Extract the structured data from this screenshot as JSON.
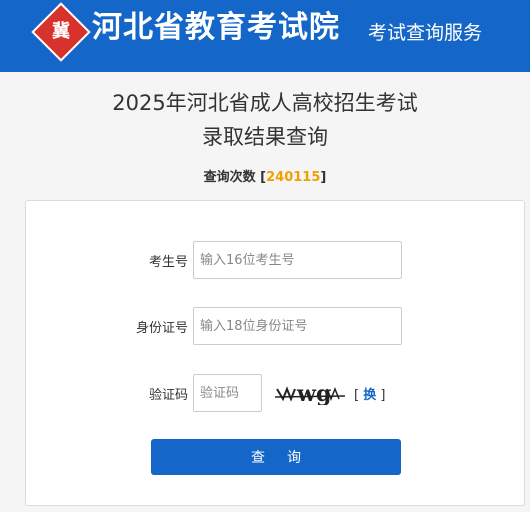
{
  "header": {
    "logo_text": "冀",
    "org_name": "河北省教育考试院",
    "service": "考试查询服务",
    "bg_color": "#1467c9"
  },
  "title_line1": "2025年河北省成人高校招生考试",
  "title_line2": "录取结果查询",
  "query_count": {
    "label": "查询次数",
    "open": "[",
    "value": "240115",
    "close": "]"
  },
  "form": {
    "exam_no": {
      "label": "考生号",
      "placeholder": "输入16位考生号"
    },
    "id_no": {
      "label": "身份证号",
      "placeholder": "输入18位身份证号"
    },
    "captcha": {
      "label": "验证码",
      "placeholder": "验证码",
      "image_text": "wg"
    },
    "refresh": {
      "open": "[",
      "label": "换",
      "close": "]"
    },
    "submit_label": "查询"
  }
}
